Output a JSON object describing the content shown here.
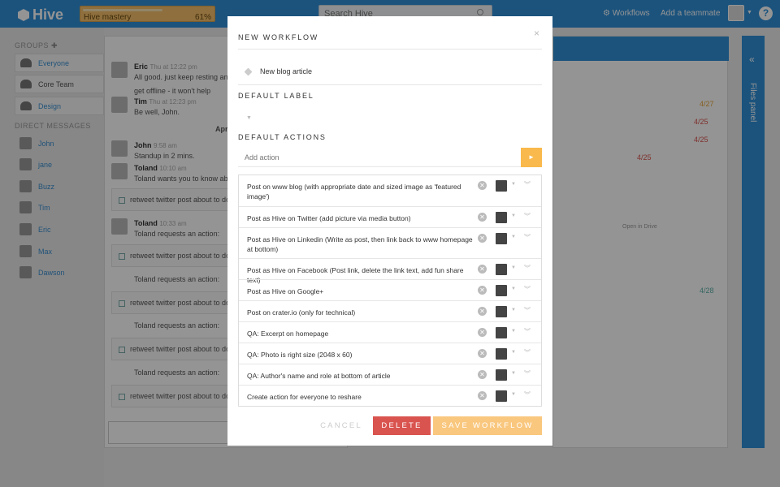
{
  "topbar": {
    "brand": "Hive",
    "mastery_label": "Hive mastery",
    "mastery_percent": "61%",
    "mastery_progress": 0.61,
    "search_placeholder": "Search Hive",
    "workflows_label": "Workflows",
    "add_teammate_label": "Add a teammate",
    "help_label": "?"
  },
  "sidebar": {
    "groups_heading": "GROUPS",
    "groups": [
      {
        "label": "Everyone"
      },
      {
        "label": "Core Team"
      },
      {
        "label": "Design"
      }
    ],
    "dm_heading": "DIRECT MESSAGES",
    "direct_messages": [
      {
        "label": "John"
      },
      {
        "label": "jane"
      },
      {
        "label": "Buzz"
      },
      {
        "label": "Tim"
      },
      {
        "label": "Eric"
      },
      {
        "label": "Max"
      },
      {
        "label": "Dawson"
      }
    ]
  },
  "chat": {
    "messages": [
      {
        "name": "Eric",
        "time": "Thu at 12:22 pm",
        "text": "All good. just keep resting and",
        "text2": "get offline - it won't help"
      },
      {
        "name": "Tim",
        "time": "Thu at 12:23 pm",
        "text": "Be well, John."
      },
      {
        "name": "John",
        "time": "9:58 am",
        "text": "Standup in 2 mins."
      },
      {
        "name": "Toland",
        "time": "10:10 am",
        "text": "Toland wants you to know abo"
      },
      {
        "name": "Toland",
        "time": "10:33 am",
        "text": "Toland requests an action:"
      }
    ],
    "date_divider": "April",
    "task_text": "retweet twitter post about to do l",
    "request_text": "Toland requests an action:"
  },
  "board": {
    "dates": [
      "4/27",
      "4/25",
      "4/25",
      "4/25",
      "4/28"
    ],
    "open_in_drive": "Open in Drive",
    "files_panel_label": "Files panel"
  },
  "modal": {
    "title": "NEW WORKFLOW",
    "close_label": "×",
    "workflow_name": "New blog article",
    "default_label_heading": "DEFAULT LABEL",
    "default_actions_heading": "DEFAULT ACTIONS",
    "add_action_placeholder": "Add action",
    "actions": [
      {
        "text": "Post on www blog (with appropriate date and sized image as 'featured image')"
      },
      {
        "text": "Post as Hive on Twitter (add picture via media button)"
      },
      {
        "text": "Post as Hive on Linkedin (Write as post, then link back to www homepage at bottom)"
      },
      {
        "text": "Post as Hive on Facebook (Post link, delete the link text, add fun share text)"
      },
      {
        "text": "Post as Hive on Google+"
      },
      {
        "text": "Post on crater.io (only for technical)"
      },
      {
        "text": "QA: Excerpt on homepage"
      },
      {
        "text": "QA: Photo is right size (2048 x 60)"
      },
      {
        "text": "QA: Author's name and role at bottom of article"
      },
      {
        "text": "Create action for everyone to reshare"
      }
    ],
    "cancel_label": "CANCEL",
    "delete_label": "DELETE",
    "save_label": "SAVE WORKFLOW"
  }
}
